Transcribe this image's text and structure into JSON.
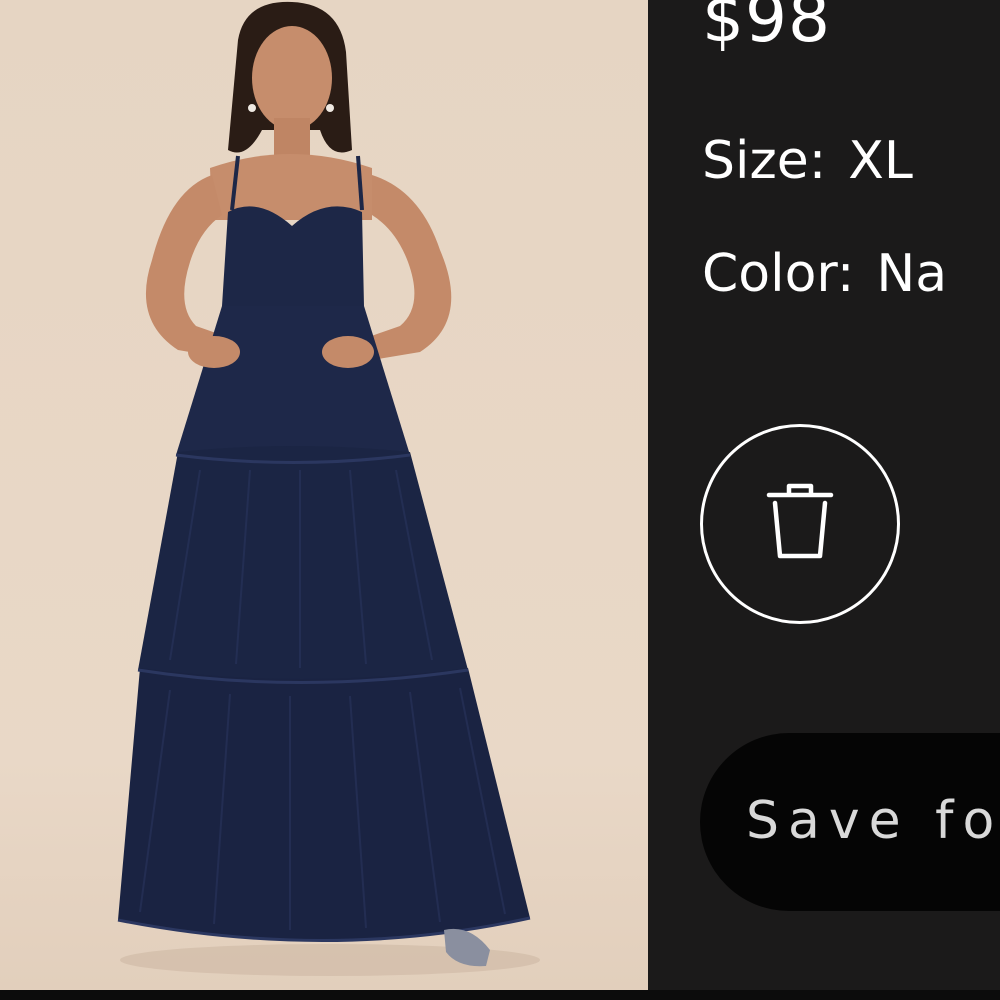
{
  "product": {
    "price": "$98",
    "size_label": "Size:",
    "size_value": "XL",
    "color_label": "Color:",
    "color_value": "Na"
  },
  "actions": {
    "remove_icon": "trash-icon",
    "save_label": "Save fo"
  },
  "colors": {
    "panel_background": "#1b1a1a",
    "photo_background": "#e8d8c6",
    "dress": "#1d2747",
    "text": "#ffffff",
    "save_button": "#050505"
  }
}
